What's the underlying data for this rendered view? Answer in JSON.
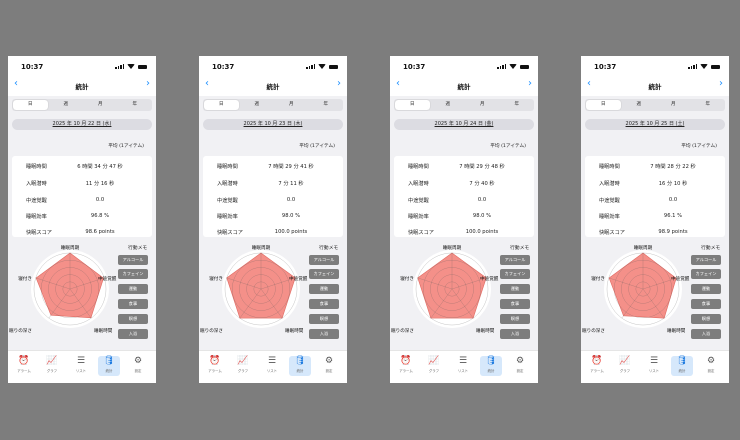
{
  "status_time": "10:37",
  "nav_title": "統計",
  "segments": [
    "日",
    "週",
    "月",
    "年"
  ],
  "active_segment": 0,
  "average_label": "平均 (1アイテム)",
  "row_labels": [
    "睡眠時間",
    "入眠潜時",
    "中途覚醒",
    "睡眠効率",
    "快眠スコア"
  ],
  "radar_labels": [
    "睡眠周期",
    "中途覚醒",
    "睡眠時間",
    "眠りの深さ",
    "寝付き"
  ],
  "memo_title": "行動メモ",
  "memo_buttons": [
    "アルコール",
    "カフェイン",
    "運動",
    "食事",
    "瞑想",
    "入浴"
  ],
  "tabs": [
    {
      "label": "アラーム",
      "icon": "alarm-clock-icon"
    },
    {
      "label": "グラフ",
      "icon": "line-chart-icon"
    },
    {
      "label": "リスト",
      "icon": "list-icon"
    },
    {
      "label": "統計",
      "icon": "database-icon"
    },
    {
      "label": "設定",
      "icon": "gear-icon"
    }
  ],
  "active_tab": 3,
  "colors": {
    "radar_fill": "#f49089",
    "accent": "#1e90ff",
    "memo_button": "#7d7d7d"
  },
  "screens": [
    {
      "date": "2025 年 10 月 22 日 (水)",
      "values": [
        "6 時間 34 分 47 秒",
        "11 分 16 秒",
        "0.0",
        "96.8 %",
        "98.6 points"
      ],
      "radar": [
        1.0,
        0.98,
        0.99,
        0.9,
        0.99
      ]
    },
    {
      "date": "2025 年 10 月 23 日 (木)",
      "values": [
        "7 時間 29 分 41 秒",
        "7 分 11 秒",
        "0.0",
        "98.0 %",
        "100.0 points"
      ],
      "radar": [
        1.0,
        1.0,
        1.0,
        1.0,
        1.0
      ]
    },
    {
      "date": "2025 年 10 月 24 日 (金)",
      "values": [
        "7 時間 29 分 48 秒",
        "7 分 40 秒",
        "0.0",
        "98.0 %",
        "100.0 points"
      ],
      "radar": [
        1.0,
        1.0,
        1.0,
        1.0,
        1.0
      ]
    },
    {
      "date": "2025 年 10 月 25 日 (土)",
      "values": [
        "7 時間 28 分 22 秒",
        "16 分 10 秒",
        "0.0",
        "96.1 %",
        "98.9 points"
      ],
      "radar": [
        1.0,
        0.97,
        1.0,
        0.92,
        0.99
      ]
    }
  ]
}
